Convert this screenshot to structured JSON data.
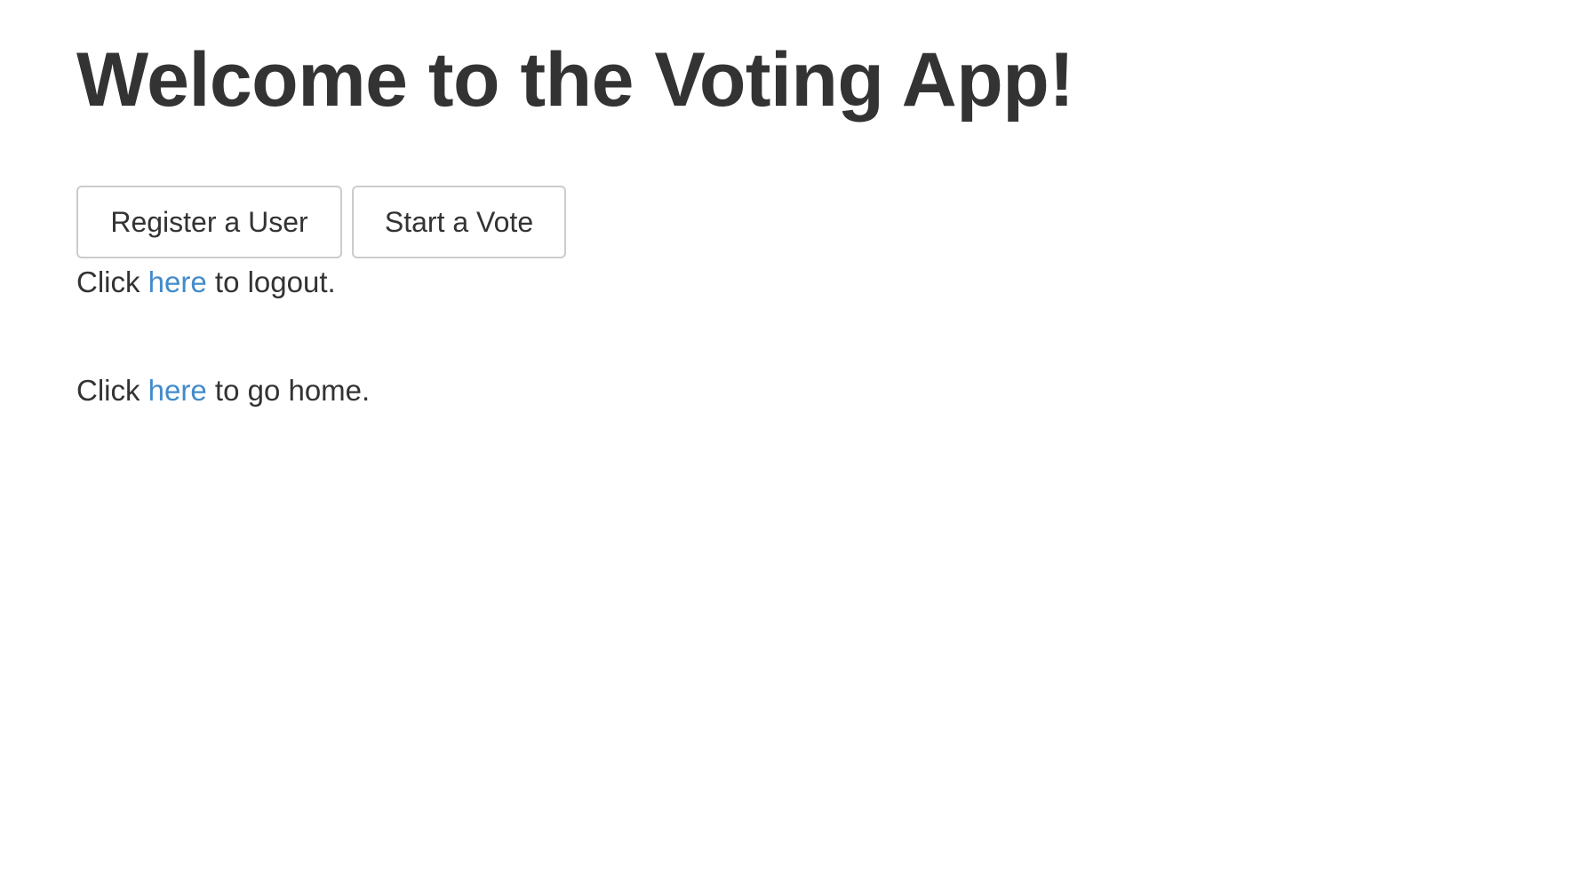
{
  "header": {
    "title": "Welcome to the Voting App!"
  },
  "actions": {
    "register_label": "Register a User",
    "start_vote_label": "Start a Vote"
  },
  "logout_line": {
    "prefix": "Click ",
    "link_text": "here",
    "suffix": " to logout."
  },
  "home_line": {
    "prefix": "Click ",
    "link_text": "here",
    "suffix": " to go home."
  },
  "colors": {
    "text": "#333333",
    "link": "#428bca",
    "button_border": "#cccccc",
    "background": "#ffffff"
  }
}
